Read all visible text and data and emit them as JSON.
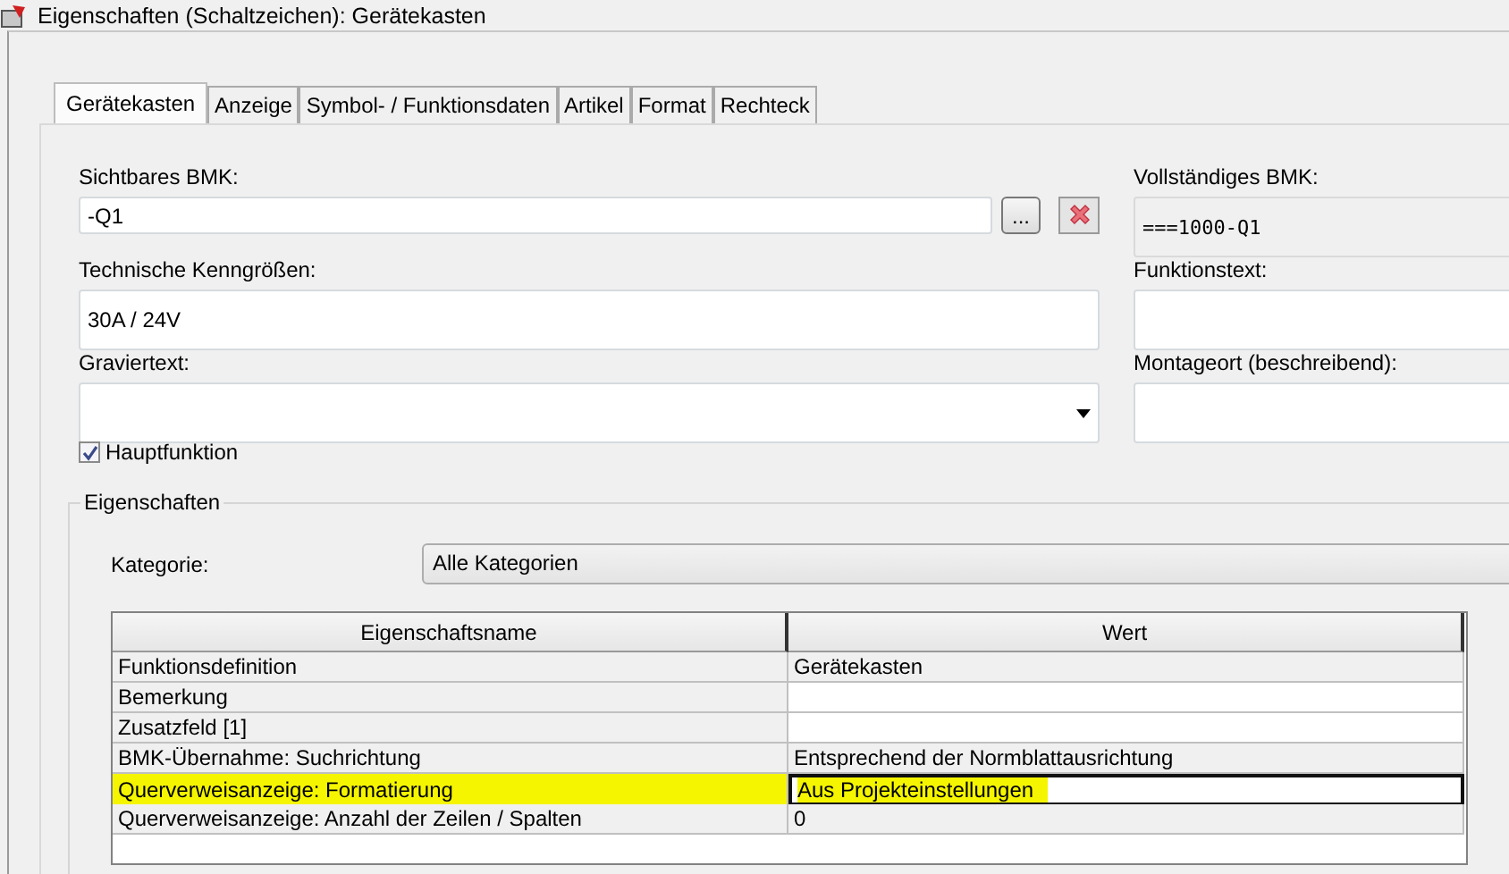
{
  "window": {
    "title": "Eigenschaften (Schaltzeichen): Gerätekasten"
  },
  "tabs": [
    {
      "label": "Gerätekasten",
      "selected": true
    },
    {
      "label": "Anzeige",
      "selected": false
    },
    {
      "label": "Symbol- / Funktionsdaten",
      "selected": false
    },
    {
      "label": "Artikel",
      "selected": false
    },
    {
      "label": "Format",
      "selected": false
    },
    {
      "label": "Rechteck",
      "selected": false
    }
  ],
  "left_fields": [
    {
      "label": "Sichtbares BMK:",
      "value": "-Q1",
      "kind": "text-with-buttons",
      "browse_button": "..."
    },
    {
      "label": "Technische Kenngrößen:",
      "value": "30A / 24V",
      "kind": "text"
    },
    {
      "label": "Graviertext:",
      "kind": "dropdown"
    }
  ],
  "right_fields": [
    {
      "label": "Vollständiges BMK:",
      "value": "===1000-Q1",
      "disabled": true
    },
    {
      "label": "Funktionstext:",
      "disabled": false
    },
    {
      "label": "Montageort (beschreibend):",
      "disabled": false
    }
  ],
  "main_function": {
    "label": "Hauptfunktion",
    "checked": true
  },
  "properties_group": {
    "title": "Eigenschaften",
    "category_label": "Kategorie:",
    "category_value": "Alle Kategorien",
    "table": {
      "columns": [
        "Eigenschaftsname",
        "Wert"
      ],
      "rows": [
        {
          "name": "Funktionsdefinition",
          "value": "Gerätekasten",
          "readonly": true,
          "selected": false
        },
        {
          "name": "Bemerkung",
          "readonly": false,
          "selected": false
        },
        {
          "name": "Zusatzfeld [1]",
          "readonly": false,
          "selected": false
        },
        {
          "name": "BMK-Übernahme: Suchrichtung",
          "value": "Entsprechend der Normblattausrichtung",
          "readonly": true,
          "selected": false
        },
        {
          "name": "Querverweisanzeige: Formatierung",
          "value": "Aus Projekteinstellungen",
          "readonly": false,
          "selected": true
        },
        {
          "name": "Querverweisanzeige: Anzahl der Zeilen / Spalten",
          "value": "0",
          "readonly": true,
          "selected": false
        }
      ]
    }
  }
}
